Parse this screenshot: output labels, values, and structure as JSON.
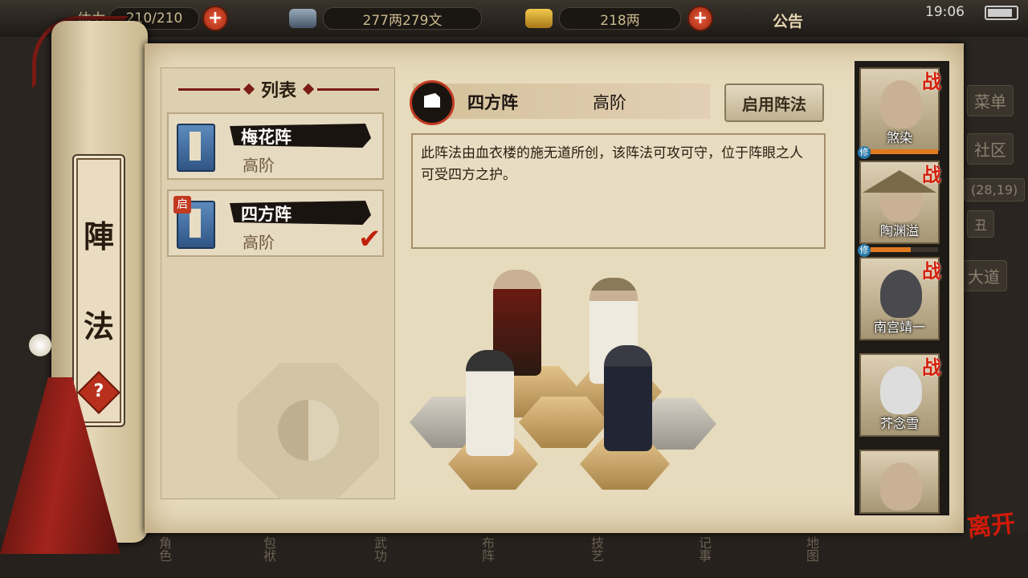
{
  "topbar": {
    "stamina_label": "体力",
    "stamina": "210/210",
    "silver": "277两279文",
    "gold": "218两",
    "notice": "公告",
    "clock": "19:06"
  },
  "side_menu": {
    "menu": "菜单",
    "community": "社区",
    "coords": "(28,19)",
    "hour": "丑",
    "road": "大道"
  },
  "bottom_menu": [
    "角色",
    "包袱",
    "武功",
    "布阵",
    "技艺",
    "记事",
    "地图"
  ],
  "scroll_title": [
    "陣",
    "法"
  ],
  "list": {
    "header": "列表",
    "items": [
      {
        "name": "梅花阵",
        "grade": "高阶",
        "active": false
      },
      {
        "name": "四方阵",
        "grade": "高阶",
        "active": true,
        "badge": "启"
      }
    ]
  },
  "detail": {
    "name": "四方阵",
    "grade": "高阶",
    "enable_label": "启用阵法",
    "description": "此阵法由血衣楼的施无道所创，该阵法可攻可守，位于阵眼之人可受四方之护。"
  },
  "roster": [
    {
      "name": "煞染",
      "tag": "战",
      "xiu": true,
      "hp": 1.0
    },
    {
      "name": "陶渊溢",
      "tag": "战",
      "xiu": true,
      "hp": 0.6
    },
    {
      "name": "南宫靖一",
      "tag": "战",
      "xiu": false
    },
    {
      "name": "芥念雪",
      "tag": "战",
      "xiu": false
    },
    {
      "name": "",
      "tag": "",
      "xiu": false
    }
  ],
  "xiu_label": "修",
  "leave_label": "离开",
  "colors": {
    "accent_red": "#c23a22",
    "parchment": "#e7dbbd",
    "ink": "#1a1410"
  }
}
